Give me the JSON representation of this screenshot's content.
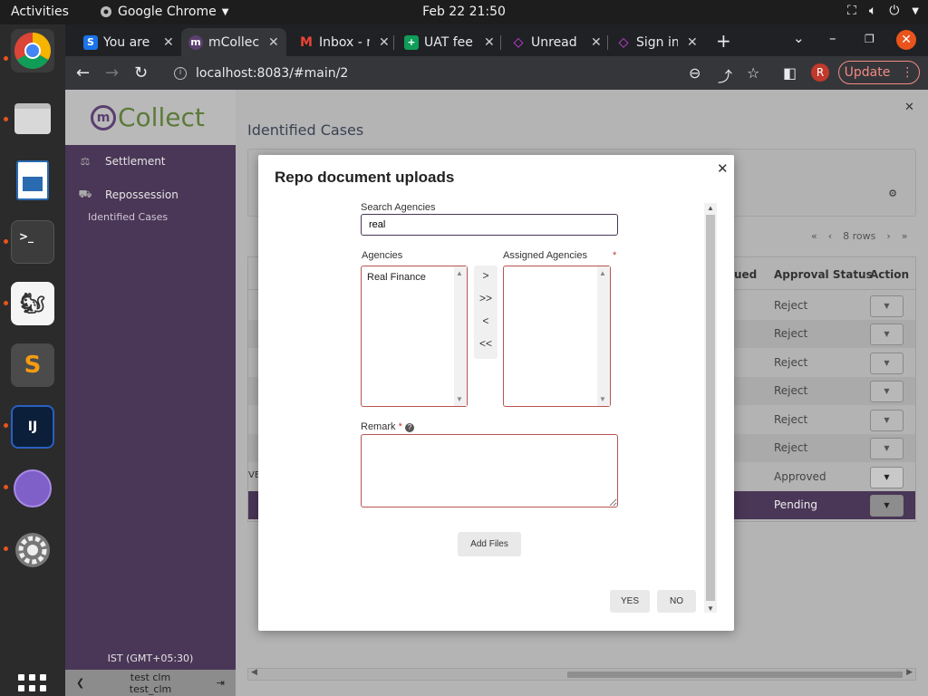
{
  "topbar": {
    "activities": "Activities",
    "app_name": "Google Chrome",
    "clock": "Feb 22  21:50"
  },
  "dock": {
    "items": [
      "chrome-icon",
      "files-icon",
      "writer-icon",
      "terminal-icon",
      "gimp-icon",
      "sublime-icon",
      "intellij-icon",
      "network-icon",
      "settings-icon",
      "app-grid-icon"
    ]
  },
  "browser": {
    "tabs": [
      {
        "label": "You are",
        "icon": "S",
        "color": "#1a73e8"
      },
      {
        "label": "mCollec",
        "icon": "m",
        "color": "#5a3f6f"
      },
      {
        "label": "Inbox - r",
        "icon": "M",
        "color": "#ea4335"
      },
      {
        "label": "UAT fee",
        "icon": "+",
        "color": "#0f9d58"
      },
      {
        "label": "Unread",
        "icon": "◇",
        "color": "#e040fb"
      },
      {
        "label": "Sign in",
        "icon": "◇",
        "color": "#e040fb"
      }
    ],
    "url": "localhost:8083/#main/2",
    "profile_initial": "R",
    "update_label": "Update"
  },
  "app": {
    "logo_m": "m",
    "logo_word": "Collect",
    "sidebar": {
      "items": [
        {
          "label": "Settlement",
          "icon": "settlement-icon"
        },
        {
          "label": "Repossession",
          "icon": "repossession-icon"
        }
      ],
      "sub_item": "Identified Cases",
      "timezone": "IST (GMT+05:30)",
      "user_line1": "test clm",
      "user_line2": "test_clm"
    },
    "page_title": "Identified Cases",
    "pager_rows": "8 rows",
    "grid": {
      "columns": [
        "ued",
        "Approval Status",
        "Action"
      ],
      "rows": [
        {
          "status": "Reject",
          "edge": ""
        },
        {
          "status": "Reject",
          "edge": ""
        },
        {
          "status": "Reject",
          "edge": ""
        },
        {
          "status": "Reject",
          "edge": ""
        },
        {
          "status": "Reject",
          "edge": ""
        },
        {
          "status": "Reject",
          "edge": ""
        },
        {
          "status": "Approved",
          "edge": "VE"
        },
        {
          "status": "Pending",
          "edge": ""
        }
      ]
    }
  },
  "modal": {
    "title": "Repo document uploads",
    "search_label": "Search Agencies",
    "search_value": "real",
    "agencies_label": "Agencies",
    "assigned_label": "Assigned Agencies",
    "agencies": [
      "Real Finance"
    ],
    "assigned": [],
    "move_buttons": [
      ">",
      ">>",
      "<",
      "<<"
    ],
    "remark_label": "Remark",
    "add_files": "Add Files",
    "yes": "YES",
    "no": "NO"
  }
}
